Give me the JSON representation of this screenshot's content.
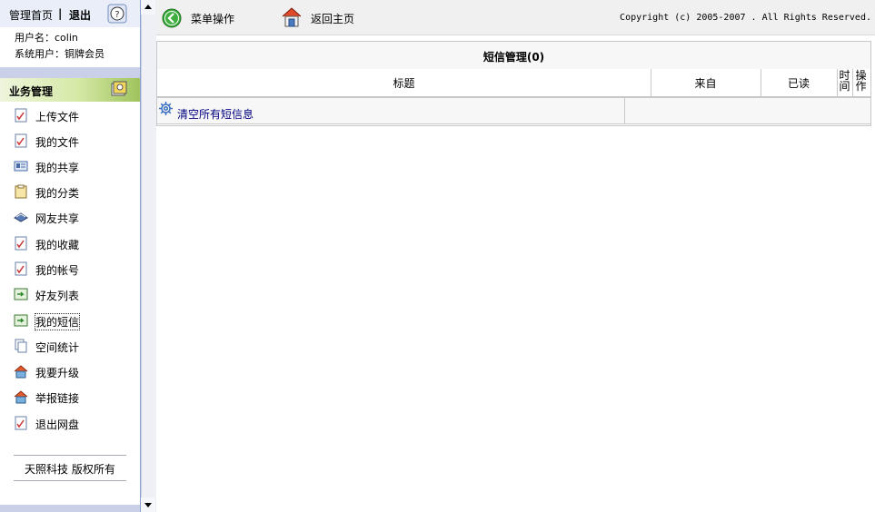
{
  "left": {
    "admin_home": "管理首页",
    "separator": "|",
    "logout": "退出",
    "username_line": "用户名：colin",
    "usertype_line": "系统用户：铜牌会员",
    "biz_header": "业务管理",
    "menu": [
      {
        "label": "上传文件",
        "icon": "document-icon"
      },
      {
        "label": "我的文件",
        "icon": "document-icon"
      },
      {
        "label": "我的共享",
        "icon": "card-icon"
      },
      {
        "label": "我的分类",
        "icon": "clipboard-icon"
      },
      {
        "label": "网友共享",
        "icon": "share-icon"
      },
      {
        "label": "我的收藏",
        "icon": "document-icon"
      },
      {
        "label": "我的帐号",
        "icon": "document-icon"
      },
      {
        "label": "好友列表",
        "icon": "friends-icon"
      },
      {
        "label": "我的短信",
        "icon": "friends-icon"
      },
      {
        "label": "空间统计",
        "icon": "pages-icon"
      },
      {
        "label": "我要升级",
        "icon": "house-icon"
      },
      {
        "label": "举报链接",
        "icon": "house-icon"
      },
      {
        "label": "退出网盘",
        "icon": "document-icon"
      }
    ],
    "footer": "天照科技 版权所有"
  },
  "toolbar": {
    "menu_ops": "菜单操作",
    "back_home": "返回主页",
    "copyright": "Copyright (c) 2005-2007 . All Rights Reserved."
  },
  "sms": {
    "title": "短信管理(0)",
    "col_title": "标题",
    "col_from": "来自",
    "col_read": "已读",
    "col_time": "时间",
    "col_op": "操作",
    "clear_all": "清空所有短信息"
  },
  "colors": {
    "accent_green": "#9fc35d",
    "frame_border": "#8aa0cf",
    "link": "#000080"
  }
}
